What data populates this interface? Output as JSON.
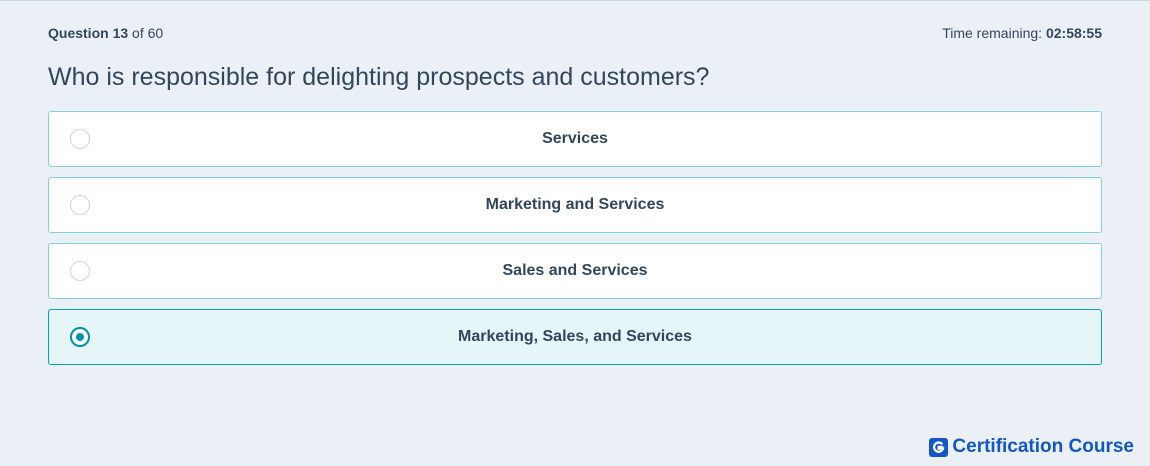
{
  "header": {
    "question_word": "Question",
    "question_number": "13",
    "of_text": "of 60",
    "timer_label": "Time remaining:",
    "timer_value": "02:58:55"
  },
  "question": {
    "text": "Who is responsible for delighting prospects and customers?"
  },
  "options": [
    {
      "label": "Services",
      "selected": false
    },
    {
      "label": "Marketing and Services",
      "selected": false
    },
    {
      "label": "Sales and Services",
      "selected": false
    },
    {
      "label": "Marketing, Sales, and Services",
      "selected": true
    }
  ],
  "brand": {
    "name": "Certification Course",
    "logo_icon": "g-logo-icon",
    "color": "#1357c7"
  },
  "colors": {
    "accent": "#0091ae",
    "option_border": "#7fd1de",
    "selected_bg": "#e5f5f8"
  }
}
